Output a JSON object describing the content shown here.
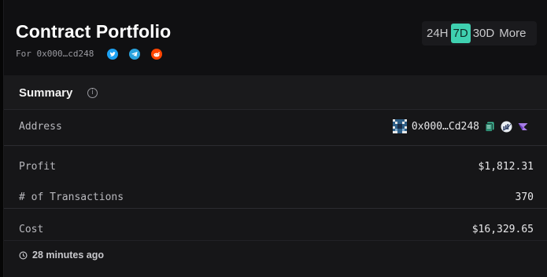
{
  "header": {
    "title": "Contract Portfolio",
    "for_label": "For 0x000…cd248",
    "social_icons": [
      "twitter-icon",
      "telegram-icon",
      "reddit-icon"
    ]
  },
  "range": {
    "options": [
      "24H",
      "7D",
      "30D",
      "More"
    ],
    "selected": "7D",
    "accent_color": "#3fd0b0"
  },
  "summary": {
    "title": "Summary",
    "info_icon": "info-icon",
    "address": {
      "label": "Address",
      "value": "0x000…Cd248"
    },
    "profit": {
      "label": "Profit",
      "value": "$1,812.31"
    },
    "transactions": {
      "label": "# of Transactions",
      "value": "370"
    },
    "cost": {
      "label": "Cost",
      "value": "$16,329.65"
    },
    "updated": "28 minutes ago"
  }
}
